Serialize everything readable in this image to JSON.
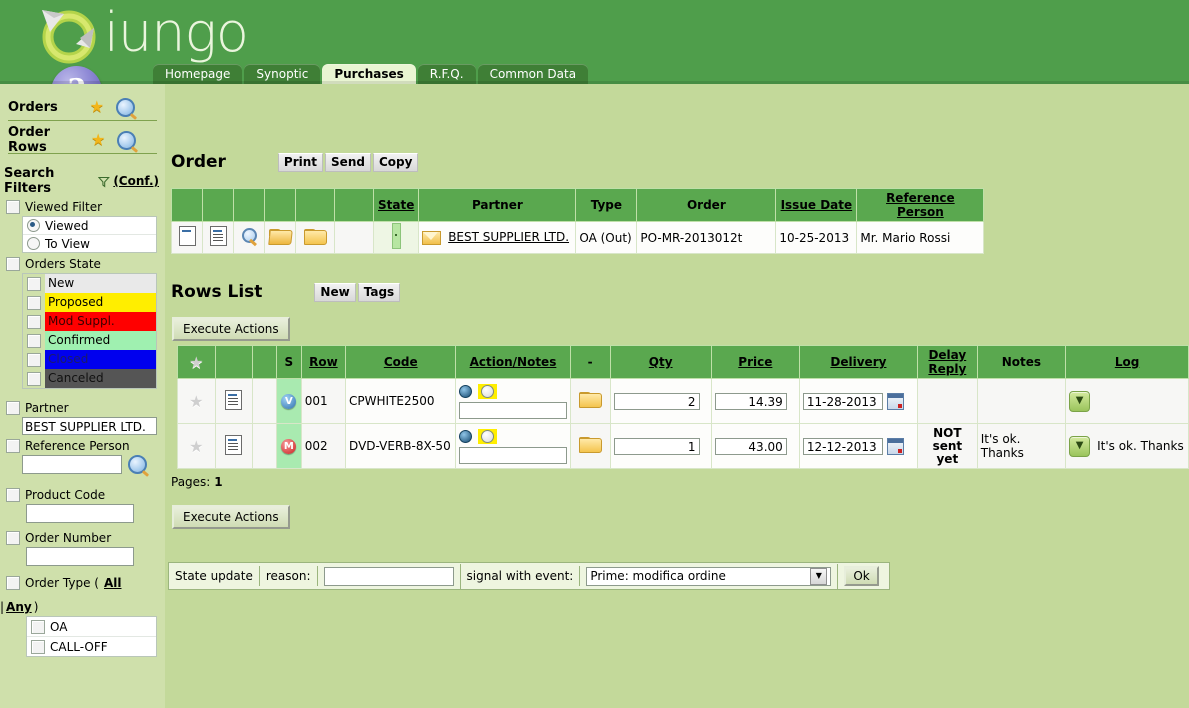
{
  "app": {
    "logo_text": "iungo",
    "help_glyph": "?"
  },
  "nav": {
    "tabs": [
      {
        "label": "Homepage",
        "active": false
      },
      {
        "label": "Synoptic",
        "active": false
      },
      {
        "label": "Purchases",
        "active": true
      },
      {
        "label": "R.F.Q.",
        "active": false
      },
      {
        "label": "Common Data",
        "active": false
      }
    ]
  },
  "sidebar": {
    "links": [
      {
        "label": "Orders"
      },
      {
        "label": "Order Rows"
      }
    ],
    "search_filters_title": "Search Filters",
    "search_filters_conf": "(Conf.)",
    "viewed_filter": {
      "label": "Viewed Filter",
      "options": [
        {
          "label": "Viewed",
          "selected": true
        },
        {
          "label": "To View",
          "selected": false
        }
      ]
    },
    "orders_state": {
      "label": "Orders State",
      "options": [
        {
          "label": "New",
          "bg": "#e9e9e9",
          "fg": "#000000"
        },
        {
          "label": "Proposed",
          "bg": "#ffee00",
          "fg": "#000000"
        },
        {
          "label": "Mod Suppl.",
          "bg": "#ff0000",
          "fg": "#3a0000"
        },
        {
          "label": "Confirmed",
          "bg": "#9ff0b0",
          "fg": "#000000"
        },
        {
          "label": "Closed",
          "bg": "#0000ee",
          "fg": "#1b1b6b"
        },
        {
          "label": "Canceled",
          "bg": "#555555",
          "fg": "#111111"
        }
      ]
    },
    "partner": {
      "label": "Partner",
      "value": "BEST SUPPLIER LTD."
    },
    "reference_person": {
      "label": "Reference Person",
      "value": ""
    },
    "product_code": {
      "label": "Product Code",
      "value": ""
    },
    "order_number": {
      "label": "Order Number",
      "value": ""
    },
    "order_type": {
      "label": "Order Type (",
      "all": "All",
      "sep": "|",
      "any": "Any",
      "close": ")",
      "options": [
        {
          "label": "OA"
        },
        {
          "label": "CALL-OFF"
        }
      ]
    }
  },
  "order": {
    "title": "Order",
    "buttons": [
      {
        "label": "Print"
      },
      {
        "label": "Send"
      },
      {
        "label": "Copy"
      }
    ],
    "headers": [
      "",
      "",
      "",
      "",
      "",
      "",
      "State",
      "Partner",
      "Type",
      "Order",
      "Issue Date",
      "Reference Person"
    ],
    "row": {
      "state": "",
      "partner": "BEST SUPPLIER LTD.",
      "type": "OA (Out)",
      "order_no": "PO-MR-2013012t",
      "issue_date": "10-25-2013",
      "reference_person": "Mr. Mario Rossi"
    }
  },
  "rows_list": {
    "title": "Rows List",
    "buttons": [
      {
        "label": "New"
      },
      {
        "label": "Tags"
      }
    ],
    "execute_top": "Execute Actions",
    "execute_bottom": "Execute Actions",
    "pages_label": "Pages:",
    "pages_value": "1",
    "headers": [
      "",
      "",
      "",
      "S",
      "Row",
      "Code",
      "Action/Notes",
      "-",
      "Qty",
      "Price",
      "Delivery",
      "Delay Reply",
      "Notes",
      "Log"
    ],
    "delay_reply_line1": "Delay",
    "delay_reply_line2": "Reply",
    "rows": [
      {
        "star": "★",
        "badge": "V",
        "badge_type": "v",
        "row": "001",
        "code": "CPWHITE2500",
        "note_value": "",
        "qty": "2",
        "price": "14.39",
        "delivery": "11-28-2013",
        "delay_reply": "",
        "notes": "",
        "log": ""
      },
      {
        "star": "★",
        "badge": "M",
        "badge_type": "m",
        "row": "002",
        "code": "DVD-VERB-8X-50",
        "note_value": "",
        "qty": "1",
        "price": "43.00",
        "delivery": "12-12-2013",
        "delay_reply": "NOT sent yet",
        "notes": "It's ok. Thanks",
        "log": "It's ok. Thanks"
      }
    ]
  },
  "state_update": {
    "label": "State update",
    "reason_label": "reason:",
    "reason_value": "",
    "signal_label": "signal with event:",
    "signal_value": "Prime: modifica ordine",
    "ok_label": "Ok"
  },
  "colors": {
    "header_green": "#4f9e4b",
    "body_bg": "#c3d99a",
    "sidebar_bg": "#cfe0ab",
    "table_header": "#5aa84f"
  }
}
